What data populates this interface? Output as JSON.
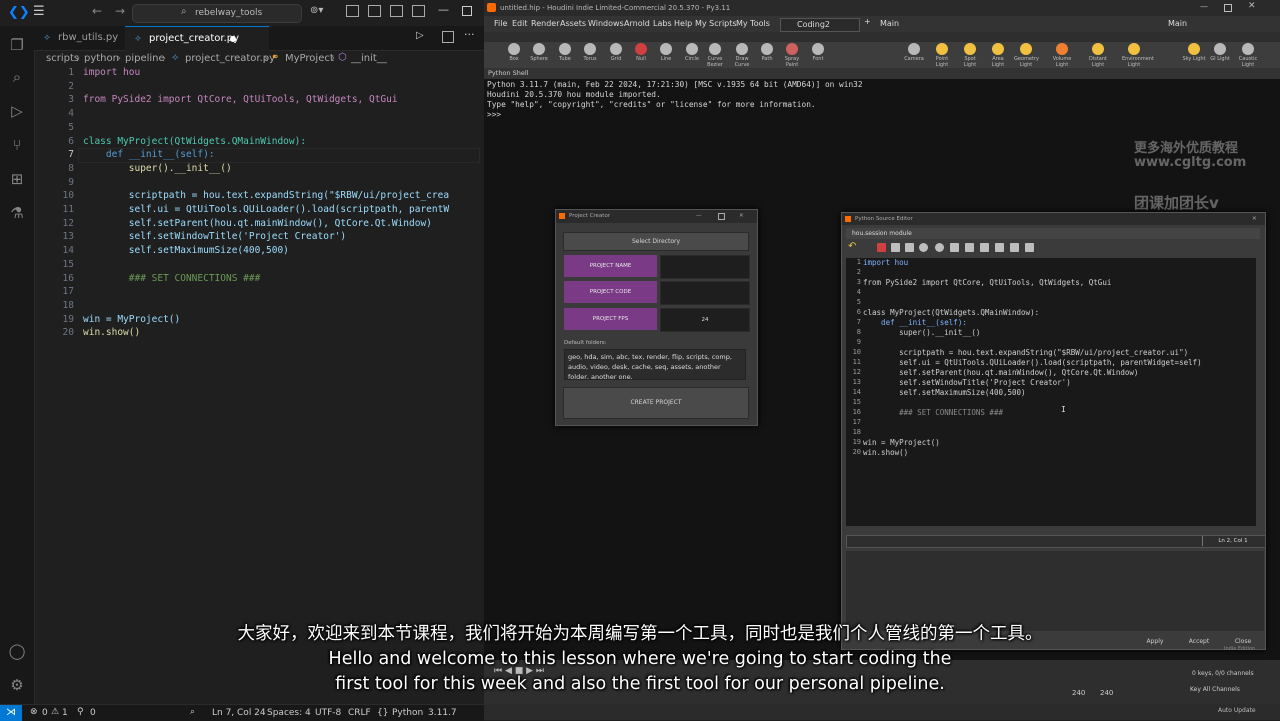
{
  "vscode": {
    "search": "rebelway_tools",
    "tabs": [
      {
        "label": "rbw_utils.py"
      },
      {
        "label": "project_creator.py"
      }
    ],
    "breadcrumb": [
      "scripts",
      "python",
      "pipeline",
      "project_creator.py",
      "MyProject",
      "__init__"
    ],
    "line_numbers": [
      "1",
      "2",
      "3",
      "4",
      "5",
      "6",
      "7",
      "8",
      "9",
      "10",
      "11",
      "12",
      "13",
      "14",
      "15",
      "16",
      "17",
      "18",
      "19",
      "20"
    ],
    "code": {
      "l1": "import hou",
      "l3": "from PySide2 import QtCore, QtUiTools, QtWidgets, QtGui",
      "l6": "class MyProject(QtWidgets.QMainWindow):",
      "l7": "    def __init__(self):",
      "l8": "        super().__init__()",
      "l10": "        scriptpath = hou.text.expandString(\"$RBW/ui/project_crea",
      "l11": "        self.ui = QtUiTools.QUiLoader().load(scriptpath, parentW",
      "l12": "        self.setParent(hou.qt.mainWindow(), QtCore.Qt.Window)",
      "l13": "        self.setWindowTitle('Project Creator')",
      "l14": "        self.setMaximumSize(400,500)",
      "l16": "        ### SET CONNECTIONS ###",
      "l19": "win = MyProject()",
      "l20": "win.show()"
    },
    "status": {
      "errors": "0",
      "warnings": "1",
      "ports": "0",
      "position": "Ln 7, Col 24",
      "spaces": "Spaces: 4",
      "encoding": "UTF-8",
      "eol": "CRLF",
      "language": "Python",
      "version": "3.11.7"
    }
  },
  "houdini": {
    "title": "untitled.hip - Houdini Indie Limited-Commercial 20.5.370 - Py3.11",
    "menu": [
      "File",
      "Edit",
      "Render",
      "Assets",
      "Windows",
      "Arnold",
      "Labs",
      "Help",
      "My Scripts",
      "My Tools"
    ],
    "desktop": "Coding2",
    "context": "Main",
    "shelf_tools_left": [
      "Box",
      "Sphere",
      "Tube",
      "Torus",
      "Grid",
      "Null",
      "Line",
      "Circle",
      "Curve Bezier",
      "Draw Curve",
      "Path",
      "Spray Paint",
      "Font"
    ],
    "shelf_tools_right": [
      "Camera",
      "Point Light",
      "Spot Light",
      "Area Light",
      "Geometry Light",
      "Volume Light",
      "Distant Light",
      "Environment Light",
      "Sky Light",
      "GI Light",
      "Caustic Light"
    ],
    "shell_tab": "Python Shell",
    "shell_lines": [
      "Python 3.11.7 (main, Feb 22 2024, 17:21:30) [MSC v.1935 64 bit (AMD64)] on win32",
      "Houdini 20.5.370 hou module imported.",
      "Type \"help\", \"copyright\", \"credits\" or \"license\" for more information.",
      ">>>"
    ],
    "project_creator": {
      "title": "Project Creator",
      "select_dir": "Select Directory",
      "name_label": "PROJECT NAME",
      "code_label": "PROJECT CODE",
      "fps_label": "PROJECT FPS",
      "fps_value": "24",
      "folders_label": "Default folders:",
      "folders_value": "geo, hda, sim, abc, tex, render, flip, scripts, comp, audio, video, desk, cache, seq, assets, another folder, another one,",
      "create": "CREATE PROJECT"
    },
    "source_editor": {
      "title": "Python Source Editor",
      "module": "hou.session module",
      "line_numbers": [
        "1",
        "2",
        "3",
        "4",
        "5",
        "6",
        "7",
        "8",
        "9",
        "10",
        "11",
        "12",
        "13",
        "14",
        "15",
        "16",
        "17",
        "18",
        "19",
        "20"
      ],
      "code": {
        "l1": "import hou",
        "l3": "from PySide2 import QtCore, QtUiTools, QtWidgets, QtGui",
        "l6": "class MyProject(QtWidgets.QMainWindow):",
        "l7": "    def __init__(self):",
        "l8": "        super().__init__()",
        "l10": "        scriptpath = hou.text.expandString(\"$RBW/ui/project_creator.ui\")",
        "l11": "        self.ui = QtUiTools.QUiLoader().load(scriptpath, parentWidget=self)",
        "l12": "        self.setParent(hou.qt.mainWindow(), QtCore.Qt.Window)",
        "l13": "        self.setWindowTitle('Project Creator')",
        "l14": "        self.setMaximumSize(400,500)",
        "l16": "        ### SET CONNECTIONS ###",
        "l19": "win = MyProject()",
        "l20": "win.show()"
      },
      "cursor_pos": "Ln 2, Col 1",
      "apply": "Apply",
      "accept": "Accept",
      "close": "Close"
    },
    "timeline": {
      "frame_end_a": "240",
      "frame_end_b": "240",
      "keys": "0 keys, 0/0 channels",
      "key_all": "Key All Channels",
      "auto_update": "Auto Update",
      "edition": "Indie Edition"
    }
  },
  "watermark": {
    "line1": "更多海外优质教程",
    "line2": "www.cgltg.com",
    "line3": "团课加团长v"
  },
  "subtitles": {
    "zh": "大家好，欢迎来到本节课程，我们将开始为本周编写第一个工具，同时也是我们个人管线的第一个工具。",
    "en1": "Hello and welcome to this lesson where we're going to start coding the",
    "en2": "first tool for this week and also the first tool for our personal pipeline."
  }
}
